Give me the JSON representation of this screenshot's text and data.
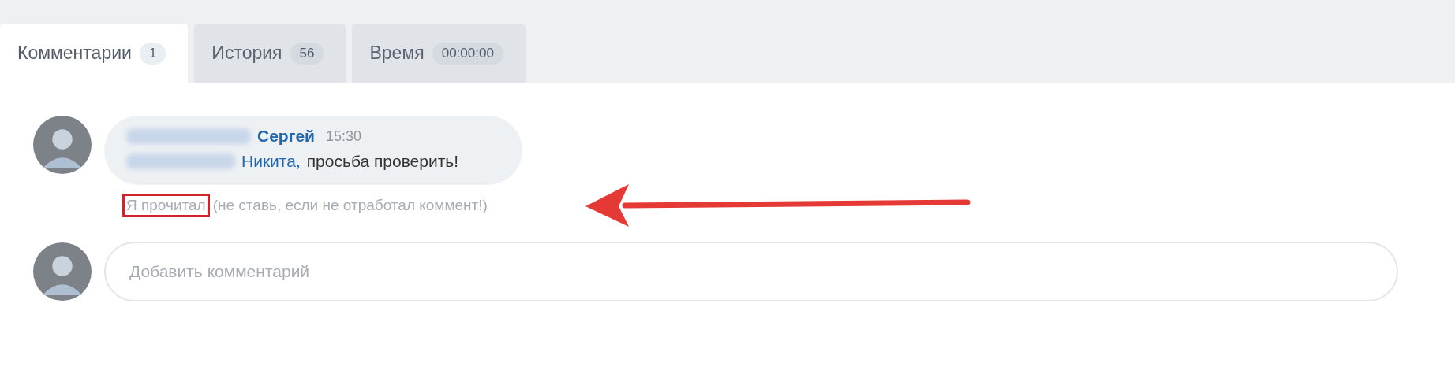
{
  "tabs": [
    {
      "label": "Комментарии",
      "count": "1",
      "selected": true
    },
    {
      "label": "История",
      "count": "56",
      "selected": false
    },
    {
      "label": "Время",
      "count": "00:00:00",
      "selected": false
    }
  ],
  "comment": {
    "author_first_name": "Сергей",
    "time": "15:30",
    "mention": "Никита,",
    "text": "просьба проверить!"
  },
  "comment_actions": {
    "read_note_highlight": "Я прочитал",
    "read_note_rest": "(не ставь, если не отработал коммент!)"
  },
  "new_comment": {
    "placeholder": "Добавить комментарий"
  }
}
